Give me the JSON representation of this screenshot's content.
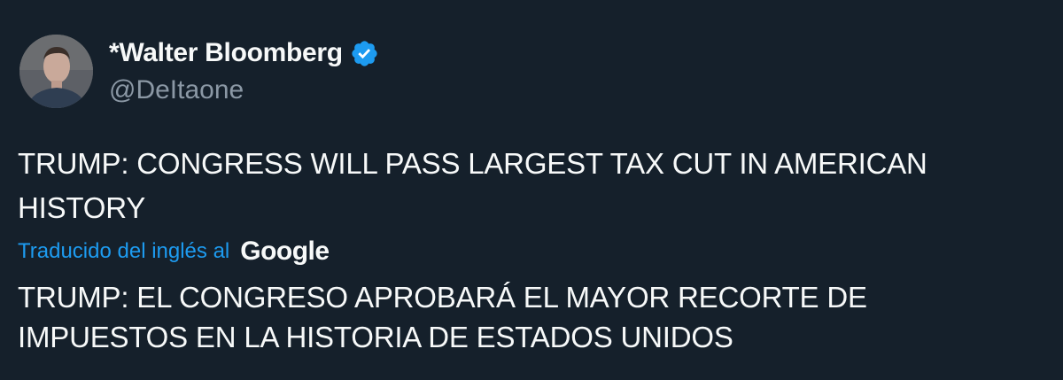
{
  "author": {
    "display_name": "*Walter Bloomberg",
    "handle": "@DeItaone",
    "verified": true,
    "verified_icon": "verified-badge-icon",
    "verified_color": "#1d9bf0",
    "avatar": "profile-photo"
  },
  "tweet": {
    "text": "TRUMP: CONGRESS WILL PASS LARGEST TAX CUT IN AMERICAN HISTORY"
  },
  "translation": {
    "label": "Traducido del inglés al",
    "provider": "Google",
    "text": "TRUMP: EL CONGRESO APROBARÁ EL MAYOR RECORTE DE IMPUESTOS EN LA HISTORIA DE ESTADOS UNIDOS"
  },
  "colors": {
    "background": "#15202b",
    "text_primary": "#f7f9f9",
    "text_secondary": "#8b98a5",
    "accent": "#1d9bf0"
  }
}
